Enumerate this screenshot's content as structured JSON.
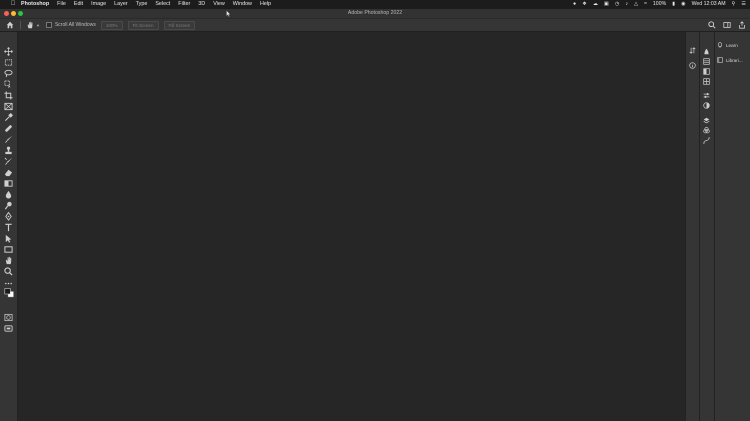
{
  "menubar": {
    "app": "Photoshop",
    "items": [
      "File",
      "Edit",
      "Image",
      "Layer",
      "Type",
      "Select",
      "Filter",
      "3D",
      "View",
      "Window",
      "Help"
    ],
    "battery": "100%",
    "clock": "Wed 12:03 AM"
  },
  "window": {
    "title": "Adobe Photoshop 2022"
  },
  "options": {
    "checkbox_label": "Scroll All Windows",
    "buttons": [
      "100%",
      "Fit Screen",
      "Fill Screen"
    ]
  },
  "panel": {
    "items": [
      "Learn",
      "Librari..."
    ]
  },
  "colors": {
    "menubar": "#1c1c1c",
    "ui": "#353535",
    "canvas": "#262626"
  }
}
